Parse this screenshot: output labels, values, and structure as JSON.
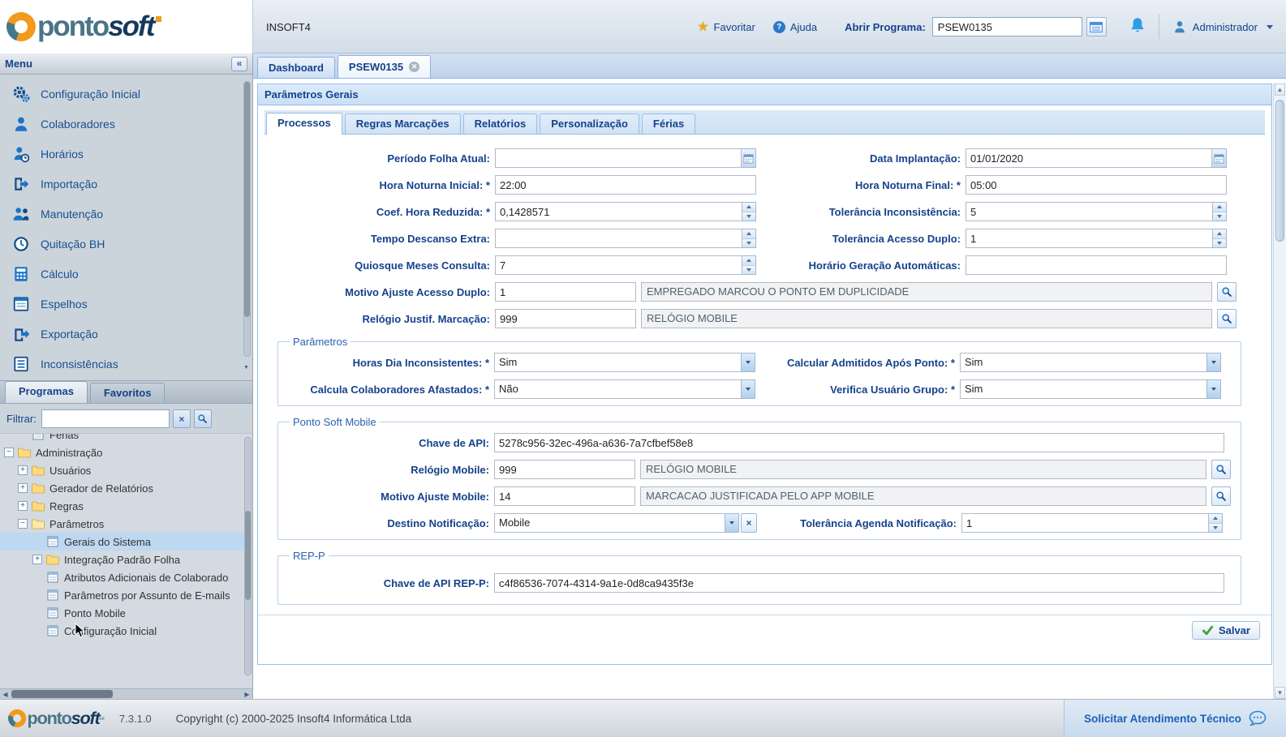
{
  "header": {
    "logo_part1": "ponto",
    "logo_part2": "soft",
    "app_code": "INSOFT4",
    "favorite_label": "Favoritar",
    "help_label": "Ajuda",
    "open_program_label": "Abrir Programa:",
    "open_program_value": "PSEW0135",
    "user_name": "Administrador"
  },
  "sidebar": {
    "menu_title": "Menu",
    "collapse_glyph": "«",
    "nav_items": [
      "Configuração Inicial",
      "Colaboradores",
      "Horários",
      "Importação",
      "Manutenção",
      "Quitação BH",
      "Cálculo",
      "Espelhos",
      "Exportação",
      "Inconsistências"
    ],
    "tabs": [
      "Programas",
      "Favoritos"
    ],
    "filter_label": "Filtrar:",
    "filter_value": "",
    "tree_clipped_item": "Férias",
    "tree_items": [
      {
        "label": "Administração"
      },
      {
        "label": "Usuários"
      },
      {
        "label": "Gerador de Relatórios"
      },
      {
        "label": "Regras"
      },
      {
        "label": "Parâmetros"
      },
      {
        "label": "Gerais do Sistema"
      },
      {
        "label": "Integração Padrão Folha"
      },
      {
        "label": "Atributos Adicionais de Colaborado"
      },
      {
        "label": "Parâmetros por Assunto de E-mails"
      },
      {
        "label": "Ponto Mobile"
      },
      {
        "label": "Configuração Inicial"
      }
    ]
  },
  "main": {
    "tab_dashboard": "Dashboard",
    "tab_program": "PSEW0135",
    "panel_title": "Parâmetros Gerais",
    "form_tabs": [
      "Processos",
      "Regras Marcações",
      "Relatórios",
      "Personalização",
      "Férias"
    ],
    "save_button": "Salvar"
  },
  "form": {
    "periodo_folha": {
      "label": "Período Folha Atual:",
      "value": ""
    },
    "data_implantacao": {
      "label": "Data Implantação:",
      "value": "01/01/2020"
    },
    "hora_noturna_inicial": {
      "label": "Hora Noturna Inicial: *",
      "value": "22:00"
    },
    "hora_noturna_final": {
      "label": "Hora Noturna Final: *",
      "value": "05:00"
    },
    "coef_hora_reduzida": {
      "label": "Coef. Hora Reduzida: *",
      "value": "0,1428571"
    },
    "tolerancia_inconsistencia": {
      "label": "Tolerância Inconsistência:",
      "value": "5"
    },
    "tempo_descanso_extra": {
      "label": "Tempo Descanso Extra:",
      "value": ""
    },
    "tolerancia_acesso_duplo": {
      "label": "Tolerância Acesso Duplo:",
      "value": "1"
    },
    "quiosque_meses_consulta": {
      "label": "Quiosque Meses Consulta:",
      "value": "7"
    },
    "horario_geracao_automaticas": {
      "label": "Horário Geração Automáticas:",
      "value": ""
    },
    "motivo_ajuste_acesso_duplo": {
      "label": "Motivo Ajuste Acesso Duplo:",
      "code": "1",
      "description": "EMPREGADO MARCOU O PONTO EM DUPLICIDADE"
    },
    "relogio_justif_marcacao": {
      "label": "Relógio Justif. Marcação:",
      "code": "999",
      "description": "RELÓGIO MOBILE"
    },
    "parametros": {
      "legend": "Parâmetros",
      "horas_dia_inconsistentes": {
        "label": "Horas Dia Inconsistentes: *",
        "value": "Sim"
      },
      "calcular_admitidos_apos_ponto": {
        "label": "Calcular Admitidos Após Ponto: *",
        "value": "Sim"
      },
      "calcula_colaboradores_afastados": {
        "label": "Calcula Colaboradores Afastados: *",
        "value": "Não"
      },
      "verifica_usuario_grupo": {
        "label": "Verifica Usuário Grupo: *",
        "value": "Sim"
      }
    },
    "ponto_soft_mobile": {
      "legend": "Ponto Soft Mobile",
      "chave_api": {
        "label": "Chave de API:",
        "value": "5278c956-32ec-496a-a636-7a7cfbef58e8"
      },
      "relogio_mobile": {
        "label": "Relógio Mobile:",
        "code": "999",
        "description": "RELÓGIO MOBILE"
      },
      "motivo_ajuste_mobile": {
        "label": "Motivo Ajuste Mobile:",
        "code": "14",
        "description": "MARCACAO JUSTIFICADA PELO APP MOBILE"
      },
      "destino_notificacao": {
        "label": "Destino Notificação:",
        "value": "Mobile"
      },
      "tolerancia_agenda_notificacao": {
        "label": "Tolerância Agenda Notificação:",
        "value": "1"
      }
    },
    "rep_p": {
      "legend": "REP-P",
      "chave_api_rep_p": {
        "label": "Chave de API REP-P:",
        "value": "c4f86536-7074-4314-9a1e-0d8ca9435f3e"
      }
    }
  },
  "footer": {
    "version": "7.3.1.0",
    "copyright": "Copyright (c) 2000-2025 Insoft4 Informática Ltda",
    "support_button": "Solicitar Atendimento Técnico",
    "logo_part1": "ponto",
    "logo_part2": "soft",
    "logo_sub": "ek"
  }
}
